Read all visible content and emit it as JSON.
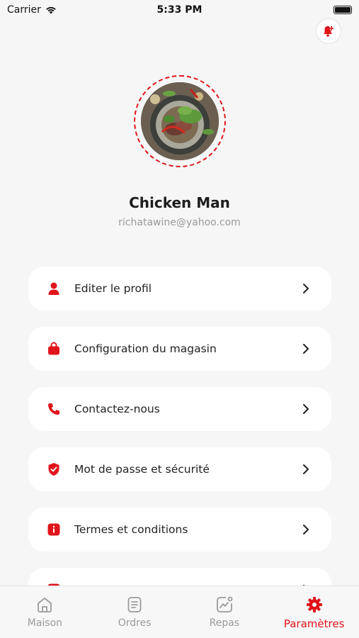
{
  "status_bar": {
    "carrier": "Carrier",
    "time": "5:33 PM"
  },
  "profile": {
    "name": "Chicken Man",
    "email": "richatawine@yahoo.com"
  },
  "menu": [
    {
      "label": "Editer le profil",
      "icon": "user-icon"
    },
    {
      "label": "Configuration du magasin",
      "icon": "shopping-bag-icon"
    },
    {
      "label": "Contactez-nous",
      "icon": "phone-icon"
    },
    {
      "label": "Mot de passe et sécurité",
      "icon": "shield-icon"
    },
    {
      "label": "Termes et conditions",
      "icon": "info-icon"
    },
    {
      "label": "",
      "icon": "partially-visible-icon"
    }
  ],
  "tabs": [
    {
      "label": "Maison",
      "icon": "home-icon"
    },
    {
      "label": "Ordres",
      "icon": "orders-icon"
    },
    {
      "label": "Repas",
      "icon": "meals-chart-icon"
    },
    {
      "label": "Paramètres",
      "icon": "gear-icon",
      "active": true
    }
  ],
  "colors": {
    "accent": "#e0141b",
    "background": "#f6f6f6",
    "card": "#ffffff",
    "muted_text": "#9a9a9a"
  }
}
